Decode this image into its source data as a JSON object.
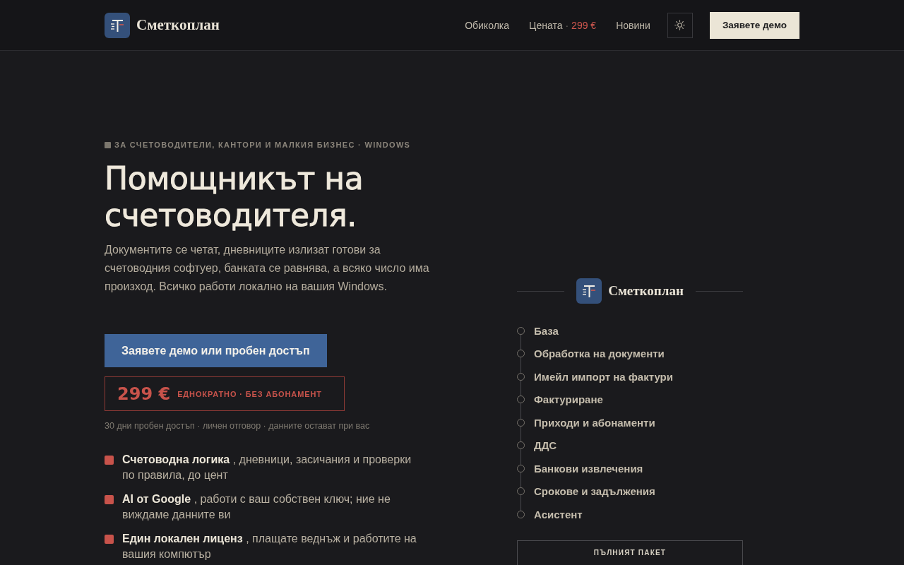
{
  "header": {
    "brand": "Сметкоплан",
    "nav": [
      {
        "label": "Обиколка"
      },
      {
        "label": "Цената",
        "separator": "·",
        "price": "299 €"
      },
      {
        "label": "Новини"
      }
    ],
    "cta": "Заявете демо"
  },
  "hero": {
    "eyebrow": "ЗА СЧЕТОВОДИТЕЛИ, КАНТОРИ И МАЛКИЯ БИЗНЕС · WINDOWS",
    "title": "Помощникът на счетоводителя.",
    "lead": "Документите се четат, дневниците излизат готови за счетоводния софтуер, банката се равнява, а всяко число има произход. Всичко работи локално на вашия Windows.",
    "button": "Заявете демо или пробен достъп",
    "price": {
      "amount": "299 €",
      "note": "ЕДНОКРАТНО · БЕЗ АБОНАМЕНТ"
    },
    "trial_note": "30 дни пробен достъп · личен отговор · данните остават при вас",
    "features": [
      "**Счетоводна логика** , дневници, засичания и проверки по правила, до цент",
      "**AI от Google** , работи с ваш собствен ключ; ние не виждаме данните ви",
      "**Един локален лиценз** , плащате веднъж и работите на вашия компютър"
    ]
  },
  "showcase": {
    "brand": "Сметкоплан",
    "modules": [
      "База",
      "Обработка на документи",
      "Имейл импорт на фактури",
      "Фактуриране",
      "Приходи и абонаменти",
      "ДДС",
      "Банкови извлечения",
      "Срокове и задължения",
      "Асистент"
    ],
    "package": {
      "label": "ПЪЛНИЯТ ПАКЕТ"
    }
  }
}
